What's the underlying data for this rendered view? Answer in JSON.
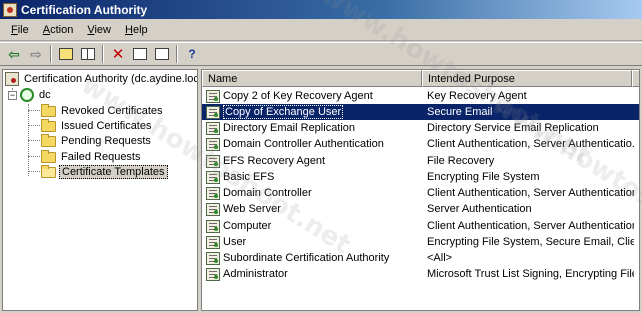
{
  "window": {
    "title": "Certification Authority"
  },
  "menu": [
    "File",
    "Action",
    "View",
    "Help"
  ],
  "toolbar": [
    {
      "name": "back-arrow-icon"
    },
    {
      "name": "forward-arrow-icon"
    },
    {
      "name": "up-folder-icon"
    },
    {
      "name": "show-hide-tree-icon"
    },
    {
      "name": "delete-icon"
    },
    {
      "name": "properties-icon"
    },
    {
      "name": "export-list-icon"
    },
    {
      "name": "help-icon"
    }
  ],
  "tree": {
    "root": "Certification Authority (dc.aydine.loc",
    "server": "dc",
    "folders": [
      "Revoked Certificates",
      "Issued Certificates",
      "Pending Requests",
      "Failed Requests",
      "Certificate Templates"
    ],
    "selected_index": 4
  },
  "list": {
    "columns": [
      "Name",
      "Intended Purpose"
    ],
    "rows": [
      {
        "name": "Copy 2 of Key Recovery Agent",
        "purpose": "Key Recovery Agent"
      },
      {
        "name": "Copy of Exchange User",
        "purpose": "Secure Email"
      },
      {
        "name": "Directory Email Replication",
        "purpose": "Directory Service Email Replication"
      },
      {
        "name": "Domain Controller Authentication",
        "purpose": "Client Authentication, Server Authenticatio..."
      },
      {
        "name": "EFS Recovery Agent",
        "purpose": "File Recovery"
      },
      {
        "name": "Basic EFS",
        "purpose": "Encrypting File System"
      },
      {
        "name": "Domain Controller",
        "purpose": "Client Authentication, Server Authentication"
      },
      {
        "name": "Web Server",
        "purpose": "Server Authentication"
      },
      {
        "name": "Computer",
        "purpose": "Client Authentication, Server Authentication"
      },
      {
        "name": "User",
        "purpose": "Encrypting File System, Secure Email, Clien..."
      },
      {
        "name": "Subordinate Certification Authority",
        "purpose": "<All>"
      },
      {
        "name": "Administrator",
        "purpose": "Microsoft Trust List Signing, Encrypting File..."
      }
    ],
    "selected_index": 1
  },
  "watermark": "www.howtoshoot.net"
}
